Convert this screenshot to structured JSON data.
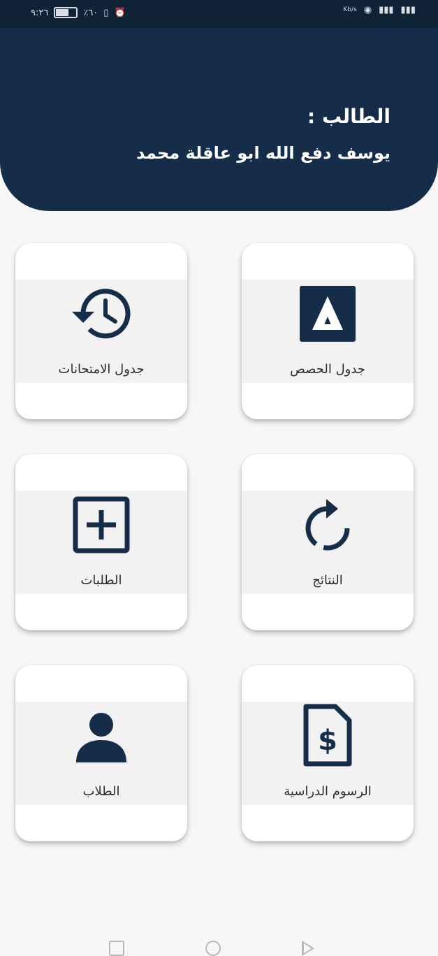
{
  "status_bar": {
    "left_text": "٩:٢٦",
    "signal_text": "٪٦٠",
    "right_glyphs": [
      "Kb/s",
      "◉",
      "▮▮▮"
    ]
  },
  "header": {
    "student_label": "الطالب :",
    "student_name": "يوسف دفع الله ابو عاقلة محمد"
  },
  "menu": {
    "items": [
      {
        "label": "جدول الحصص",
        "icon": "app-logo-a-icon"
      },
      {
        "label": "جدول الامتحانات",
        "icon": "history-clock-icon"
      },
      {
        "label": "النتائج",
        "icon": "refresh-icon"
      },
      {
        "label": "الطلبات",
        "icon": "add-box-icon"
      },
      {
        "label": "الرسوم الدراسية",
        "icon": "fee-document-icon"
      },
      {
        "label": "الطلاب",
        "icon": "person-icon"
      }
    ]
  },
  "colors": {
    "header_bg": "#152d48",
    "status_bg": "#0f2236",
    "icon_color": "#152d48",
    "card_bg": "#ffffff"
  }
}
